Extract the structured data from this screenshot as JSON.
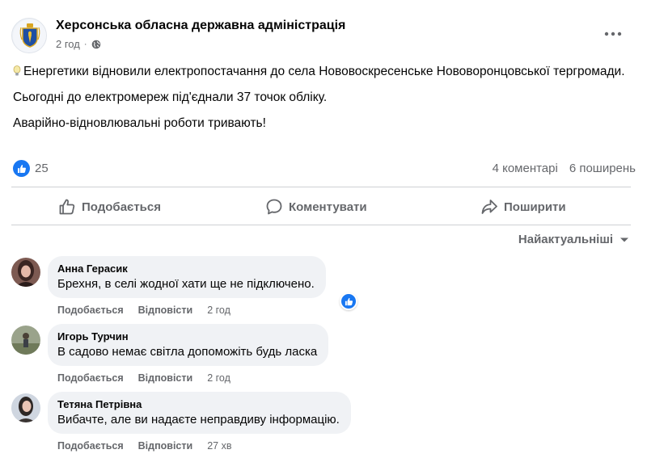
{
  "post": {
    "page_name": "Херсонська обласна державна адміністрація",
    "time": "2 год",
    "dot": "·",
    "more_label": "•••",
    "paragraphs": [
      "Енергетики відновили електропостачання до села Нововоскресенське Нововоронцовської тергромади.",
      "Сьогодні до електромереж під'єднали 37 точок обліку.",
      "Аварійно-відновлювальні роботи тривають!"
    ],
    "reaction_count": "25",
    "comments_count": "4 коментарі",
    "shares_count": "6 поширень"
  },
  "actions": {
    "like": "Подобається",
    "comment": "Коментувати",
    "share": "Поширити"
  },
  "sort": {
    "label": "Найактуальніші"
  },
  "comments": [
    {
      "author": "Анна Герасик",
      "text": "Брехня, в селі жодної хати ще не підключено.",
      "like": "Подобається",
      "reply": "Відповісти",
      "time": "2 год"
    },
    {
      "author": "Игорь Турчин",
      "text": "В садово немає світла допоможіть будь ласка",
      "like": "Подобається",
      "reply": "Відповісти",
      "time": "2 год"
    },
    {
      "author": "Тетяна Петрівна",
      "text": "Вибачте, але ви надаєте неправдиву інформацію.",
      "like": "Подобається",
      "reply": "Відповісти",
      "time": "27 хв"
    }
  ],
  "colors": {
    "accent": "#1877f2",
    "secondary_text": "#65676b",
    "bubble": "#f0f2f5"
  },
  "icons": [
    "coat-of-arms-icon",
    "globe-icon",
    "more-icon",
    "light-bulb-icon",
    "like-reaction-icon",
    "thumbs-up-icon",
    "comment-icon",
    "share-icon",
    "chevron-down-icon"
  ]
}
